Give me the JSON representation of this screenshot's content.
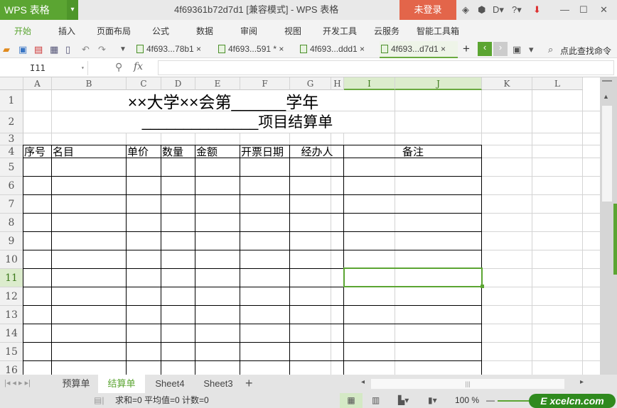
{
  "app": {
    "name": "WPS 表格",
    "window_title": "4f69361b72d7d1 [兼容模式] - WPS 表格",
    "login": "未登录"
  },
  "menu": [
    "开始",
    "插入",
    "页面布局",
    "公式",
    "数据",
    "审阅",
    "视图",
    "开发工具",
    "云服务",
    "智能工具箱"
  ],
  "file_tabs": [
    {
      "label": "4f693...78b1 ×"
    },
    {
      "label": "4f693...591 * ×"
    },
    {
      "label": "4f693...ddd1 ×"
    },
    {
      "label": "4f693...d7d1 ×"
    }
  ],
  "search_command": "点此查找命令",
  "formula_bar": {
    "cell_ref": "I11",
    "fx": "fx",
    "value": ""
  },
  "columns": [
    "A",
    "B",
    "C",
    "D",
    "E",
    "F",
    "G",
    "H",
    "I",
    "J",
    "K",
    "L"
  ],
  "rows": [
    "1",
    "2",
    "3",
    "4",
    "5",
    "6",
    "7",
    "8",
    "9",
    "10",
    "11",
    "12",
    "13",
    "14",
    "15",
    "16"
  ],
  "sheet": {
    "title1": "××大学××会第______学年",
    "title2": "______________项目结算单",
    "headers": [
      "序号",
      "名目",
      "单价",
      "数量",
      "金额",
      "开票日期",
      "经办人",
      "备注"
    ]
  },
  "selected_cell": "I11",
  "sheet_tabs": [
    "预算单",
    "结算单",
    "Sheet4",
    "Sheet3"
  ],
  "active_sheet": "结算单",
  "status": {
    "summary": "求和=0  平均值=0  计数=0",
    "zoom": "100 %"
  },
  "watermark": "Excelcn.com",
  "accent": "#5ba532"
}
